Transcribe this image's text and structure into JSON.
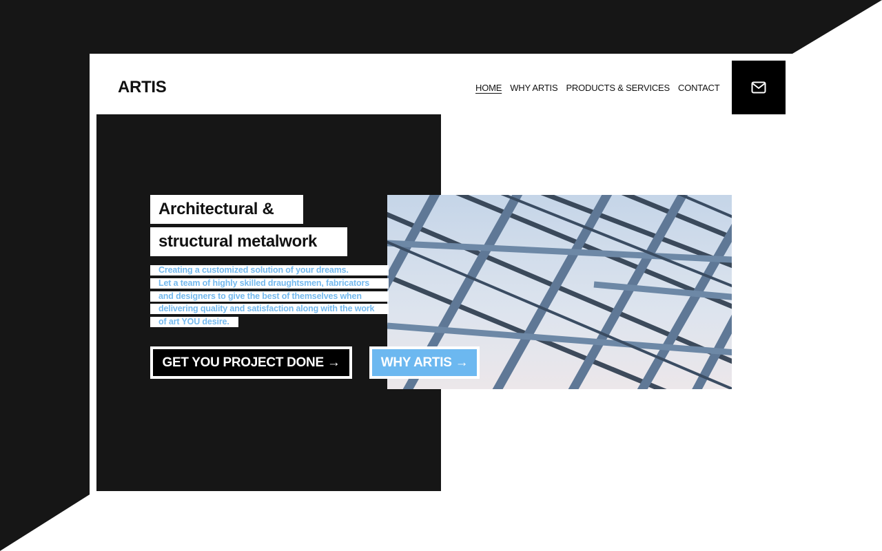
{
  "brand": {
    "logo": "ARTIS"
  },
  "nav": {
    "items": [
      {
        "label": "HOME",
        "active": true
      },
      {
        "label": "WHY ARTIS",
        "active": false
      },
      {
        "label": "PRODUCTS & SERVICES",
        "active": false
      },
      {
        "label": "CONTACT",
        "active": false
      }
    ],
    "mail_icon": "mail-icon"
  },
  "hero": {
    "headline_line1": "Architectural &",
    "headline_line2": "structural metalwork",
    "description_lines": [
      "Creating a customized solution of your dreams.",
      "Let a team of highly skilled draughtsmen, fabricators",
      "and designers to give the best of themselves when",
      "delivering quality and satisfaction along with the work",
      "of art YOU desire."
    ],
    "primary_button": "GET YOU PROJECT DONE",
    "secondary_button": "WHY ARTIS",
    "arrow": "→",
    "image_alt": "steel lattice roof structure"
  },
  "colors": {
    "background_dark": "#161616",
    "accent_blue": "#6cb8f0",
    "text_blue": "#74b9ee",
    "black": "#000000",
    "white": "#ffffff"
  }
}
